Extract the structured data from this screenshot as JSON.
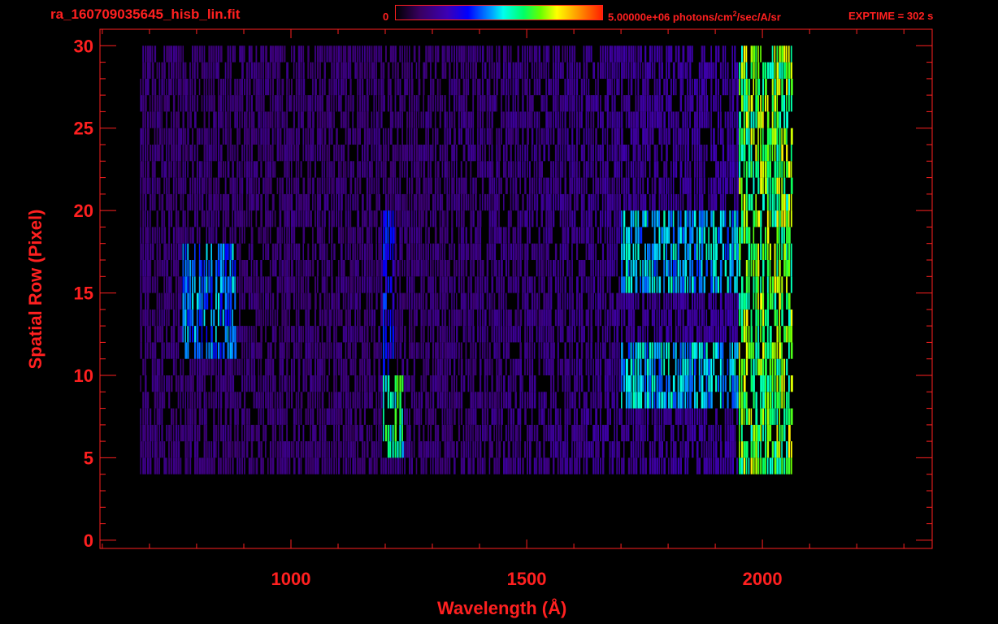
{
  "header": {
    "filename": "ra_160709035645_hisb_lin.fit",
    "colorbar_min": "0",
    "colorbar_max_prefix": "5.00000e+06 photons/cm",
    "colorbar_max_sup": "2",
    "colorbar_max_suffix": "/sec/A/sr",
    "exptime": "EXPTIME = 302 s"
  },
  "colors": {
    "axis": "#ff2020",
    "background": "#000000"
  },
  "chart_data": {
    "type": "heatmap",
    "title": "ra_160709035645_hisb_lin.fit",
    "xlabel": "Wavelength (Å)",
    "ylabel": "Spatial Row (Pixel)",
    "xlim": [
      595,
      2360
    ],
    "ylim": [
      -0.5,
      31
    ],
    "xticks": [
      1000,
      1500,
      2000
    ],
    "yticks": [
      0,
      5,
      10,
      15,
      20,
      25,
      30
    ],
    "colorscale": {
      "min": 0,
      "max": 5000000,
      "unit": "photons/cm^2/sec/A/sr"
    },
    "data_extent": {
      "x": [
        680,
        2065
      ],
      "y": [
        4,
        30
      ]
    },
    "features": [
      {
        "name": "emission-blob-left",
        "x": [
          770,
          880
        ],
        "y": [
          11,
          18
        ],
        "level": 0.45
      },
      {
        "name": "emission-line-1216",
        "x": [
          1195,
          1235
        ],
        "y": [
          5,
          10
        ],
        "level": 0.6
      },
      {
        "name": "emission-line-1216-weak",
        "x": [
          1195,
          1215
        ],
        "y": [
          10,
          20
        ],
        "level": 0.35
      },
      {
        "name": "bright-band-upper",
        "x": [
          1700,
          2060
        ],
        "y": [
          15,
          20
        ],
        "level": 0.5
      },
      {
        "name": "bright-band-lower",
        "x": [
          1700,
          2060
        ],
        "y": [
          8,
          12
        ],
        "level": 0.5
      },
      {
        "name": "red-edge",
        "x": [
          1950,
          2065
        ],
        "y": [
          4,
          30
        ],
        "level": 0.7
      }
    ]
  }
}
